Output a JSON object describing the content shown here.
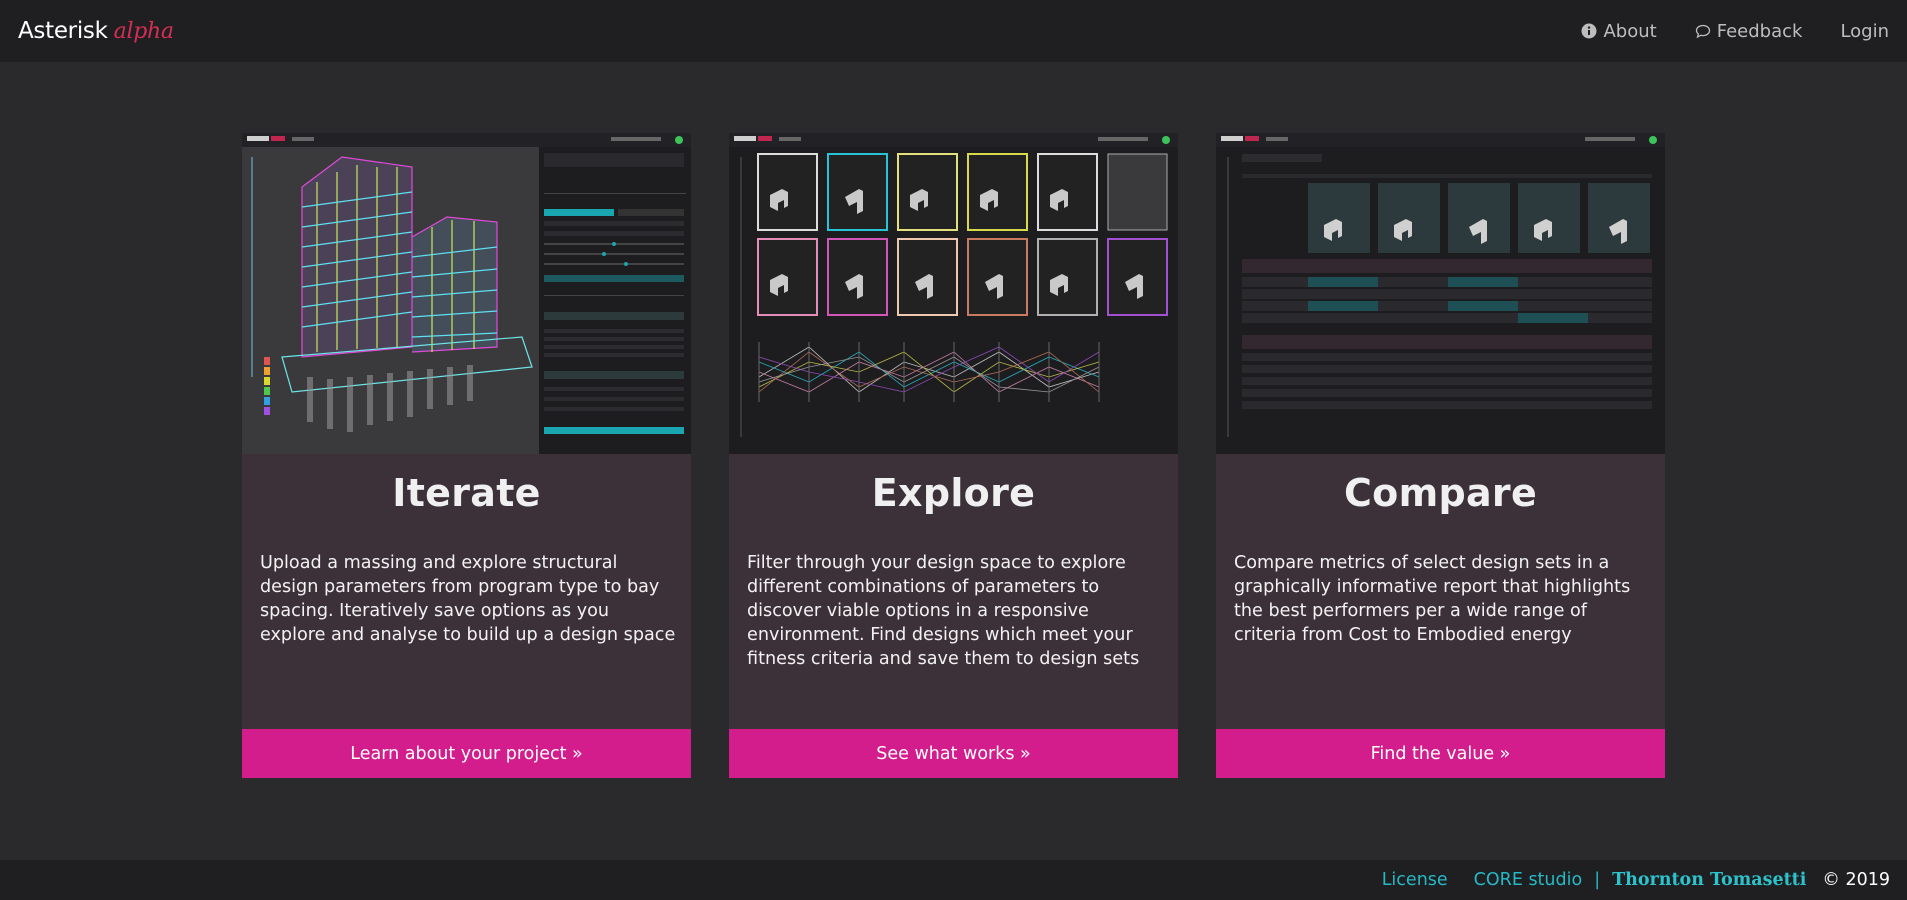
{
  "brand": {
    "name": "Asterisk",
    "tag": "alpha"
  },
  "nav": {
    "about": "About",
    "feedback": "Feedback",
    "login": "Login",
    "icons": {
      "about": "info-circle-icon",
      "feedback": "comment-icon"
    }
  },
  "cards": [
    {
      "title": "Iterate",
      "text": "Upload a massing and explore structural design parameters from program type to bay spacing. Iteratively save options as you explore and analyse to build up a design space",
      "cta": "Learn about your project »"
    },
    {
      "title": "Explore",
      "text": "Filter through your design space to explore different combinations of parameters to discover viable options in a responsive environment. Find designs which meet your fitness criteria and save them to design sets",
      "cta": "See what works »"
    },
    {
      "title": "Compare",
      "text": "Compare metrics of select design sets in a graphically informative report that highlights the best performers per a wide range of criteria from Cost to Embodied energy",
      "cta": "Find the value »"
    }
  ],
  "footer": {
    "license": "License",
    "core": "CORE studio",
    "separator": "|",
    "company": "Thornton Tomasetti",
    "copyright": "© 2019"
  },
  "colors": {
    "background": "#2a2a2c",
    "navbar": "#1f1f21",
    "card": "#3d3139",
    "accent": "#d41d8c",
    "alpha": "#d42e55",
    "teal": "#25b9c5"
  }
}
